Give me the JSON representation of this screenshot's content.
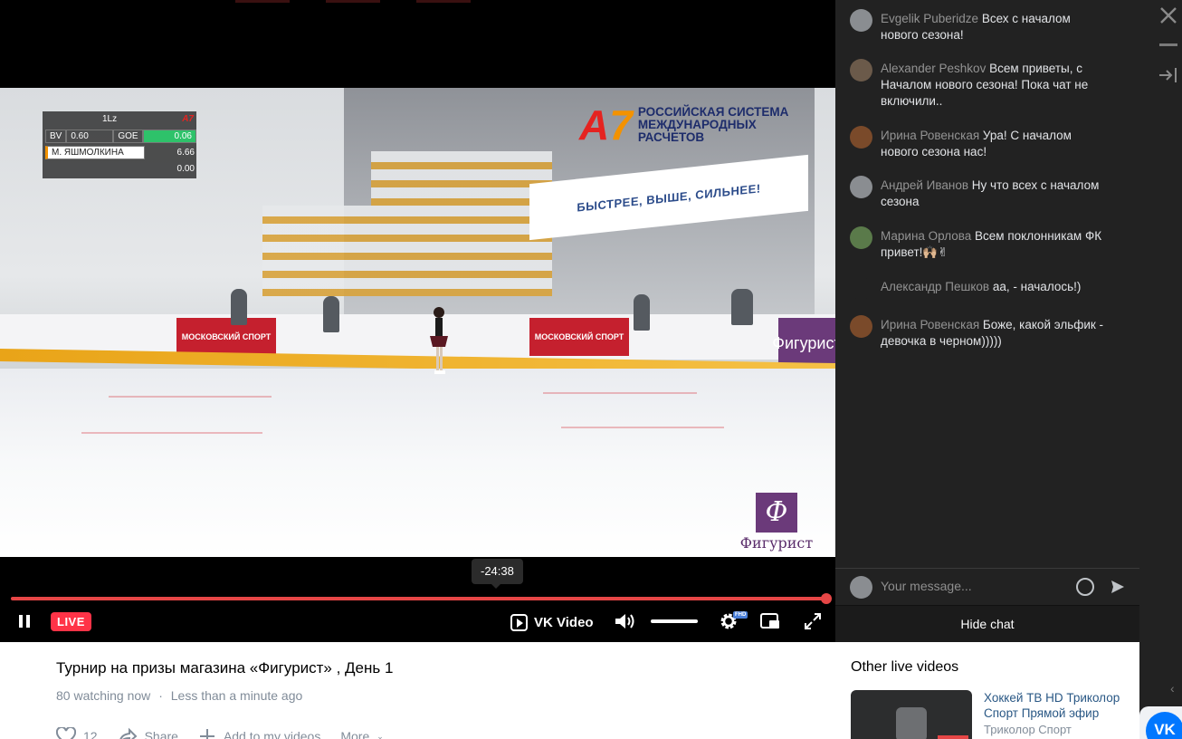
{
  "player": {
    "scoreboard": {
      "element": "1Lz",
      "bv_label": "BV",
      "bv_value": "0.60",
      "goe_label": "GOE",
      "goe_value": "0.06",
      "skater": "М. ЯШМОЛКИНА",
      "total": "6.66",
      "deductions": "0.00"
    },
    "sponsor_logo": {
      "mark": "А7",
      "line1": "РОССИЙСКАЯ СИСТЕМА",
      "line2": "МЕЖДУНАРОДНЫХ",
      "line3": "РАСЧЕТОВ"
    },
    "arena_banner": "БЫСТРЕЕ, ВЫШЕ, СИЛЬНЕЕ!",
    "board_moscow_sport": "МОСКОВСКИЙ СПОРТ",
    "watermark": "Фигурист",
    "watermark_mark": "Ф",
    "time_tooltip": "-24:38",
    "progress": 1.0,
    "live_label": "LIVE",
    "brand_label": "VK Video",
    "quality_badge": "FHD",
    "accent_color": "#e64646"
  },
  "video_info": {
    "title": "Турнир на призы магазина «Фигурист» , День 1",
    "watching": "80 watching now",
    "separator": "·",
    "time_ago": "Less than a minute ago",
    "likes": "12",
    "share_label": "Share",
    "add_label": "Add to my videos",
    "more_label": "More"
  },
  "chat": {
    "messages": [
      {
        "author": "Evgelik Puberidze",
        "text": "Всех с началом нового сезона!",
        "avatar_color": "#8a8d91"
      },
      {
        "author": "Alexander Peshkov",
        "text": "Всем приветы, с Началом нового сезона! Пока чат не включили..",
        "avatar_color": "#6b5a4a"
      },
      {
        "author": "Ирина Ровенская",
        "text": "Ура! С началом нового сезона нас!",
        "avatar_color": "#7a4a2a"
      },
      {
        "author": "Андрей Иванов",
        "text": "Ну что всех с началом сезона",
        "avatar_color": "#8a8d91"
      },
      {
        "author": "Марина Орлова",
        "text": "Всем поклонникам ФК привет!🙌🏼✌",
        "avatar_color": "#5a7a4a"
      },
      {
        "author": "Александр Пешков",
        "text": "аа, - началось!)",
        "avatar_color": "#222222"
      },
      {
        "author": "Ирина Ровенская",
        "text": "Боже, какой эльфик - девочка в черном)))))",
        "avatar_color": "#7a4a2a"
      }
    ],
    "input_placeholder": "Your message...",
    "hide_chat_label": "Hide chat"
  },
  "other_videos": {
    "heading": "Other live videos",
    "items": [
      {
        "title": "Хоккей ТВ HD Триколор Спорт Прямой эфир",
        "owner": "Триколор Спорт"
      }
    ]
  },
  "rail": {
    "vk_label": "VK"
  }
}
